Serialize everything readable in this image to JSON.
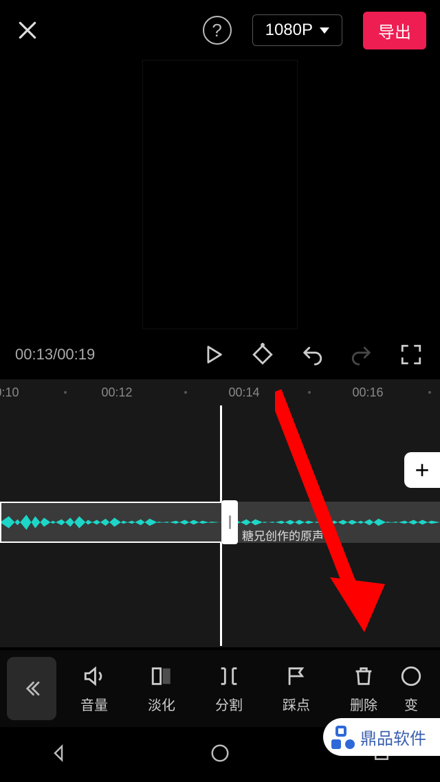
{
  "header": {
    "resolution": "1080P",
    "export_label": "导出"
  },
  "player": {
    "current_time": "00:13",
    "total_time": "00:19"
  },
  "ruler_ticks": [
    "0:10",
    "00:12",
    "00:14",
    "00:16"
  ],
  "audio": {
    "clip_label": "糖兄创作的原声"
  },
  "tools": {
    "volume": "音量",
    "fade": "淡化",
    "split": "分割",
    "beat": "踩点",
    "delete": "删除",
    "change": "变"
  },
  "watermark": "鼎品软件"
}
